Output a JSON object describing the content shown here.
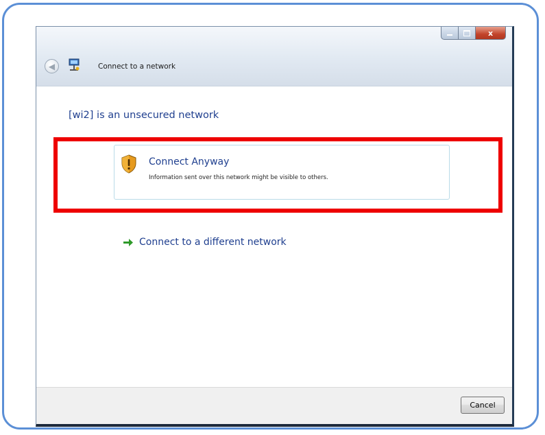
{
  "window": {
    "title": "Connect to a network",
    "controls": {
      "close_glyph": "x"
    }
  },
  "main": {
    "heading": "[wi2] is an unsecured network",
    "options": {
      "connect_anyway": {
        "title": "Connect Anyway",
        "description": "Information sent over this network might be visible to others.",
        "icon": "warning-shield-icon"
      },
      "different_network": {
        "label": "Connect to a different network",
        "icon": "green-arrow-icon"
      }
    },
    "highlight_color": "#ee0000"
  },
  "footer": {
    "cancel_label": "Cancel"
  },
  "colors": {
    "frame_border": "#5b8fd6",
    "link_text": "#1f3f8f",
    "arrow_green": "#2f9a2a",
    "shield_amber": "#e69a1e"
  }
}
